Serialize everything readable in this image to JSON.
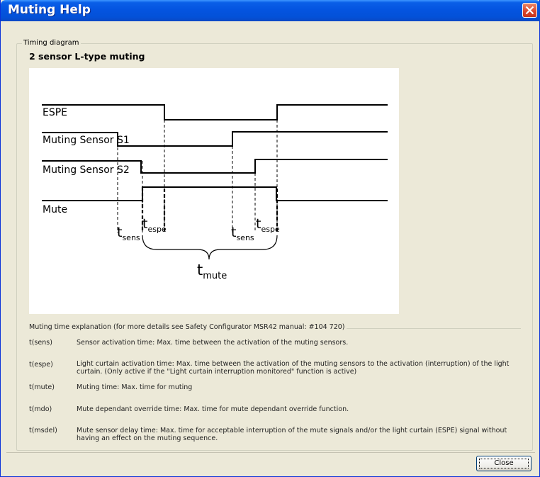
{
  "window": {
    "title": "Muting Help"
  },
  "group": {
    "legend": "Timing diagram",
    "diagram_title": "2 sensor L-type muting"
  },
  "diagram": {
    "signals": [
      "ESPE",
      "Muting Sensor S1",
      "Muting Sensor S2",
      "Mute"
    ],
    "labels": {
      "t": "t",
      "sens": "sens",
      "espe": "espe",
      "mute": "mute"
    }
  },
  "explanation": {
    "header": "Muting time explanation (for more details see Safety Configurator MSR42 manual: #104 720)",
    "items": [
      {
        "term": "t(sens)",
        "desc": "Sensor activation time: Max. time between the activation of the muting sensors."
      },
      {
        "term": "t(espe)",
        "desc": "Light curtain activation time: Max. time between the activation of the muting sensors to the activation (interruption) of the light curtain. (Only active if the \"Light curtain interruption monitored\" function is active)"
      },
      {
        "term": "t(mute)",
        "desc": "Muting time: Max. time for muting"
      },
      {
        "term": "t(mdo)",
        "desc": "Mute dependant override time: Max. time for mute dependant override function."
      },
      {
        "term": "t(msdel)",
        "desc": "Mute sensor delay time: Max. time for acceptable interruption of the mute signals and/or the light curtain (ESPE) signal without having an effect on the muting sequence."
      }
    ]
  },
  "buttons": {
    "close": "Close"
  }
}
